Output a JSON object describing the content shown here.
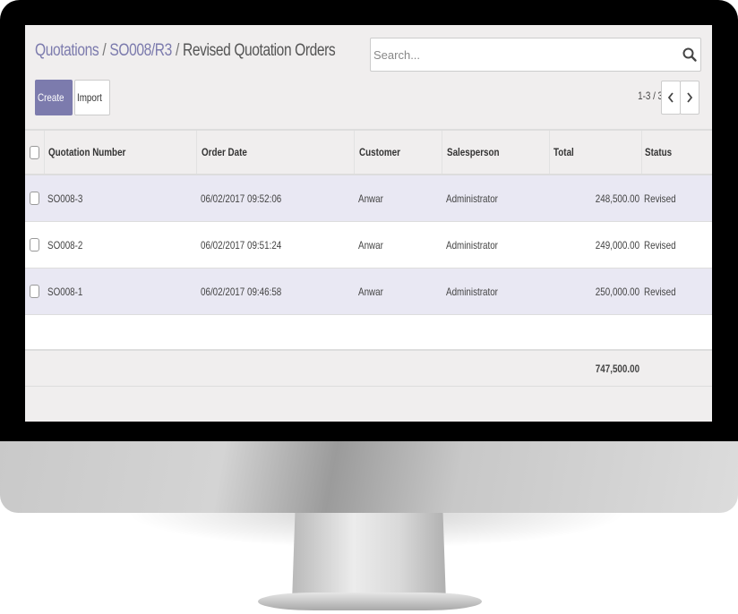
{
  "breadcrumb": {
    "items": [
      "Quotations",
      "SO008/R3"
    ],
    "separator": "/",
    "current": "Revised Quotation Orders"
  },
  "search": {
    "placeholder": "Search...",
    "icon": "search-icon"
  },
  "buttons": {
    "create": "Create",
    "import": "Import"
  },
  "pager": {
    "value": "1-3 / 3",
    "prev_icon": "chevron-left-icon",
    "next_icon": "chevron-right-icon"
  },
  "table": {
    "columns": [
      "Quotation Number",
      "Order Date",
      "Customer",
      "Salesperson",
      "Total",
      "Status"
    ],
    "rows": [
      {
        "number": "SO008-3",
        "date": "06/02/2017 09:52:06",
        "customer": "Anwar",
        "salesperson": "Administrator",
        "total": "248,500.00",
        "status": "Revised"
      },
      {
        "number": "SO008-2",
        "date": "06/02/2017 09:51:24",
        "customer": "Anwar",
        "salesperson": "Administrator",
        "total": "249,000.00",
        "status": "Revised"
      },
      {
        "number": "SO008-1",
        "date": "06/02/2017 09:46:58",
        "customer": "Anwar",
        "salesperson": "Administrator",
        "total": "250,000.00",
        "status": "Revised"
      }
    ],
    "footer_total": "747,500.00"
  },
  "colors": {
    "accent": "#7c7bad",
    "row_highlight": "#e9e8f3",
    "panel_background": "#f0eeee"
  }
}
